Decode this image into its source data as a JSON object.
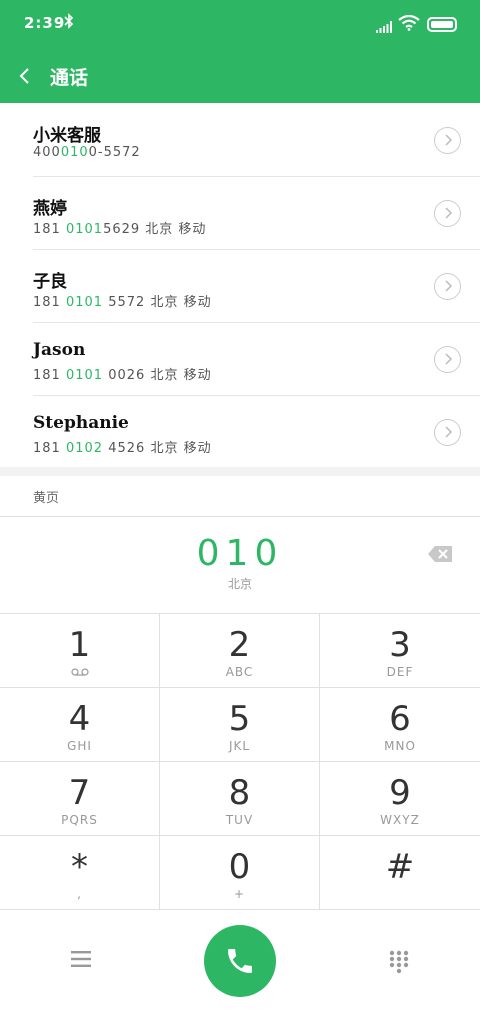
{
  "status_bar": {
    "time": "2:39",
    "bluetooth_icon": "bluetooth-icon"
  },
  "nav": {
    "title": "通话"
  },
  "contacts": [
    {
      "name": "小米客服",
      "prefix": "400",
      "highlight": "010",
      "rest": "0-5572",
      "location": ""
    },
    {
      "name": "燕婷",
      "prefix": "181",
      "highlight": "0101",
      "rest": "5629",
      "location": "北京 移动"
    },
    {
      "name": "子良",
      "prefix": "181",
      "highlight": "0101",
      "rest": "5572",
      "location": "北京 移动"
    },
    {
      "name": "Jason",
      "prefix": "181",
      "highlight": "0101",
      "rest": "0026",
      "location": "北京 移动"
    },
    {
      "name": "Stephanie",
      "prefix": "181",
      "highlight": "0102",
      "rest": "4526",
      "location": "北京 移动"
    }
  ],
  "more_label": "黄页",
  "dial": {
    "number": "010",
    "location": "北京"
  },
  "keys": [
    {
      "digit": "1",
      "letters": "ᴏᴏ"
    },
    {
      "digit": "2",
      "letters": "ABC"
    },
    {
      "digit": "3",
      "letters": "DEF"
    },
    {
      "digit": "4",
      "letters": "GHI"
    },
    {
      "digit": "5",
      "letters": "JKL"
    },
    {
      "digit": "6",
      "letters": "MNO"
    },
    {
      "digit": "7",
      "letters": "PQRS"
    },
    {
      "digit": "8",
      "letters": "TUV"
    },
    {
      "digit": "9",
      "letters": "WXYZ"
    },
    {
      "digit": "*",
      "letters": ","
    },
    {
      "digit": "0",
      "letters": "+"
    },
    {
      "digit": "#",
      "letters": ""
    }
  ],
  "colors": {
    "accent": "#2db765",
    "divider": "#e0e0e0"
  }
}
